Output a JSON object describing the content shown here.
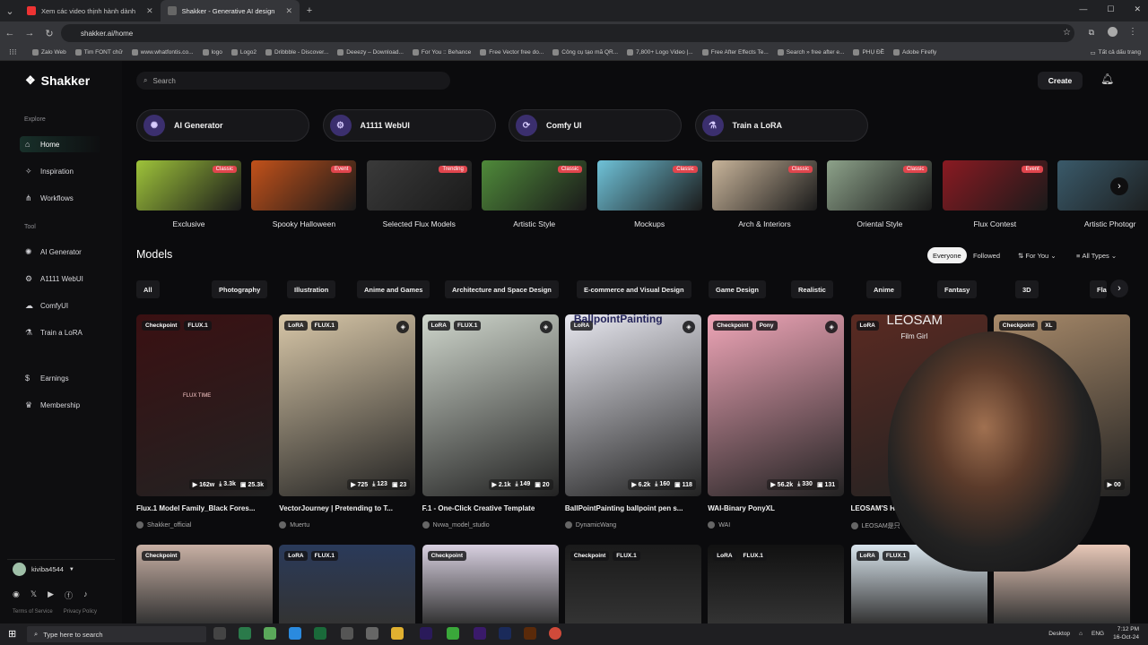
{
  "browser": {
    "tabs": [
      {
        "title": "Xem các video thịnh hành dành",
        "active": false
      },
      {
        "title": "Shakker - Generative AI design",
        "active": true
      }
    ],
    "url": "shakker.ai/home",
    "bookmarks": [
      "Zalo Web",
      "Tim FONT chữ",
      "www.whatfontis.co...",
      "logo",
      "Logo2",
      "Dribbble - Discover...",
      "Deeezy – Download...",
      "For You :: Behance",
      "Free Vector free do...",
      "Công cụ tạo mã QR...",
      "7,800+ Logo Video |...",
      "Free After Effects Te...",
      "Search » free after e...",
      "PHỤ ĐỀ",
      "Adobe Firefly"
    ],
    "bookmarks_folder": "Tất cả dấu trang"
  },
  "app": {
    "logo": "Shakker",
    "search_placeholder": "Search",
    "create_label": "Create",
    "sidebar": {
      "explore_label": "Explore",
      "explore_items": [
        {
          "label": "Home",
          "icon": "home-icon",
          "active": true
        },
        {
          "label": "Inspiration",
          "icon": "compass-icon"
        },
        {
          "label": "Workflows",
          "icon": "workflow-icon"
        }
      ],
      "tool_label": "Tool",
      "tool_items": [
        {
          "label": "AI Generator",
          "icon": "generator-icon"
        },
        {
          "label": "A1111 WebUI",
          "icon": "webui-icon"
        },
        {
          "label": "ComfyUI",
          "icon": "comfy-icon"
        },
        {
          "label": "Train a LoRA",
          "icon": "lora-icon"
        }
      ],
      "other_items": [
        {
          "label": "Earnings",
          "icon": "earnings-icon"
        },
        {
          "label": "Membership",
          "icon": "membership-icon"
        }
      ],
      "username": "kiviba4544",
      "legal": [
        "Terms of Service",
        "Privacy Policy"
      ]
    },
    "tools": [
      {
        "label": "AI Generator"
      },
      {
        "label": "A1111 WebUI"
      },
      {
        "label": "Comfy UI"
      },
      {
        "label": "Train a LoRA"
      }
    ],
    "categories": [
      {
        "label": "Exclusive",
        "badge": "Classic",
        "color": "#9ec33a"
      },
      {
        "label": "Spooky Halloween",
        "badge": "Event",
        "color": "#c2511a"
      },
      {
        "label": "Selected Flux Models",
        "badge": "Trending",
        "color": "#3a3a3a"
      },
      {
        "label": "Artistic Style",
        "badge": "Classic",
        "color": "#4f8a3a"
      },
      {
        "label": "Mockups",
        "badge": "Classic",
        "color": "#6fc2d8"
      },
      {
        "label": "Arch & Interiors",
        "badge": "Classic",
        "color": "#c8b49a"
      },
      {
        "label": "Oriental Style",
        "badge": "Classic",
        "color": "#8da28a"
      },
      {
        "label": "Flux Contest",
        "badge": "Event",
        "color": "#8a1a22"
      },
      {
        "label": "Artistic Photogr",
        "badge": "",
        "color": "#3a5a6a"
      }
    ],
    "models_title": "Models",
    "filters": {
      "everyone": "Everyone",
      "followed": "Followed",
      "sort": "For You",
      "types": "All Types"
    },
    "chips": [
      "All",
      "Photography",
      "Illustration",
      "Anime and Games",
      "Architecture and Space Design",
      "E-commerce and Visual Design",
      "Game Design",
      "Realistic",
      "Anime",
      "Fantasy",
      "3D",
      "Fla"
    ],
    "models": [
      {
        "title": "Flux.1 Model Family_Black Fores...",
        "author": "Shakker_official",
        "tags": [
          "Checkpoint",
          "FLUX.1"
        ],
        "stats": [
          "162w",
          "3.3k",
          "25.3k"
        ],
        "color": "#3a1012"
      },
      {
        "title": "VectorJourney | Pretending to T...",
        "author": "Muertu",
        "tags": [
          "LoRA",
          "FLUX.1"
        ],
        "stats": [
          "725",
          "123",
          "23"
        ],
        "color": "#d8c7a8"
      },
      {
        "title": "F.1 - One-Click Creative Template",
        "author": "Nvwa_model_studio",
        "tags": [
          "LoRA",
          "FLUX.1"
        ],
        "stats": [
          "2.1k",
          "149",
          "20"
        ],
        "color": "#cfd6cc"
      },
      {
        "title": "BallPointPainting ballpoint pen s...",
        "author": "DynamicWang",
        "tags": [
          "LoRA"
        ],
        "stats": [
          "6.2k",
          "160",
          "118"
        ],
        "color": "#e8e8f0"
      },
      {
        "title": "WAI-Binary PonyXL",
        "author": "WAI",
        "tags": [
          "Checkpoint",
          "Pony"
        ],
        "stats": [
          "56.2k",
          "330",
          "131"
        ],
        "color": "#f0a6b8"
      },
      {
        "title": "LEOSAM'S H",
        "author": "LEOSAM是只",
        "tags": [
          "LoRA"
        ],
        "stats": [],
        "color": "#5a2a22"
      },
      {
        "title": "istic Bi...",
        "author": "",
        "tags": [
          "Checkpoint",
          "XL"
        ],
        "stats": [
          "00"
        ],
        "color": "#a88a6a"
      }
    ],
    "models_row2": [
      {
        "tags": [
          "Checkpoint"
        ],
        "color": "#c8b0a4"
      },
      {
        "tags": [
          "LoRA",
          "FLUX.1"
        ],
        "color": "#2a3a5a"
      },
      {
        "tags": [
          "Checkpoint"
        ],
        "color": "#d8d0e0"
      },
      {
        "tags": [
          "Checkpoint",
          "FLUX.1"
        ],
        "color": "#1a1a1a"
      },
      {
        "tags": [
          "LoRA",
          "FLUX.1"
        ],
        "color": "#111"
      },
      {
        "tags": [
          "LoRA",
          "FLUX.1"
        ],
        "color": "#d8e4ec"
      },
      {
        "tags": [],
        "color": "#e8c8b8"
      }
    ],
    "card_text": {
      "flux_time": "FLUX TIME",
      "ballpoint": "BallpointPainting",
      "leosam": "LEOSAM",
      "film_girl": "Film Girl"
    }
  },
  "taskbar": {
    "search_placeholder": "Type here to search",
    "desktop_label": "Desktop",
    "lang": "ENG",
    "time": "7:12 PM",
    "date": "16-Oct-24"
  }
}
